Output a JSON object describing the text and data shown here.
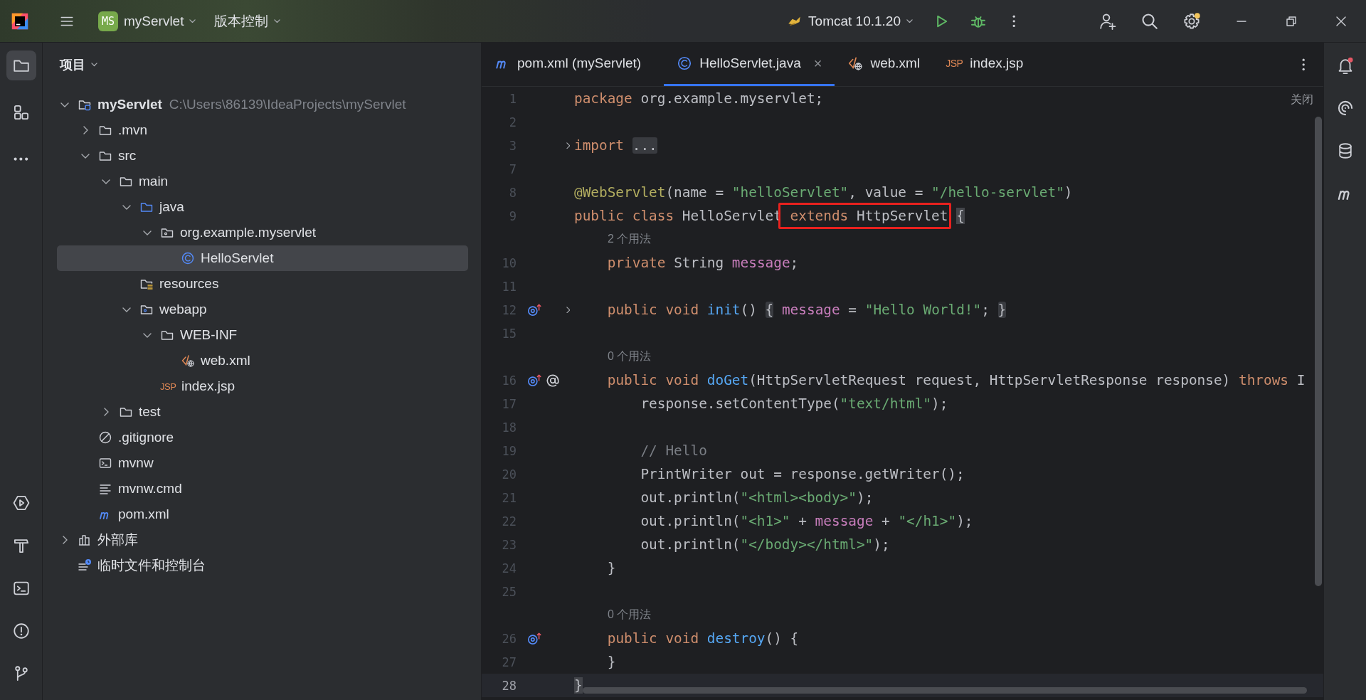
{
  "title_bar": {
    "project_badge": "MS",
    "project": "myServlet",
    "vcs": "版本控制",
    "run_config": "Tomcat 10.1.20"
  },
  "left_toolbar": {
    "top": [
      {
        "kind": "project",
        "selected": true
      },
      {
        "kind": "structure",
        "selected": false
      },
      {
        "kind": "more",
        "selected": false
      }
    ],
    "bottom": [
      {
        "kind": "services",
        "selected": false
      },
      {
        "kind": "build",
        "selected": false
      },
      {
        "kind": "terminal",
        "selected": false
      },
      {
        "kind": "problems",
        "selected": false
      },
      {
        "kind": "git",
        "selected": false
      }
    ]
  },
  "right_toolbar": [
    {
      "kind": "notifications",
      "selected": false
    },
    {
      "kind": "ai",
      "selected": false
    },
    {
      "kind": "database",
      "selected": false
    },
    {
      "kind": "maven",
      "selected": false
    }
  ],
  "project_panel": {
    "title": "项目",
    "tree": [
      {
        "label": "myServlet",
        "path": "C:\\Users\\86139\\IdeaProjects\\myServlet",
        "kind": "project",
        "expanded": true,
        "selected": false,
        "children": [
          {
            "label": ".mvn",
            "kind": "folder",
            "expanded": false,
            "selected": false
          },
          {
            "label": "src",
            "kind": "folder",
            "expanded": true,
            "selected": false,
            "children": [
              {
                "label": "main",
                "kind": "folder",
                "expanded": true,
                "selected": false,
                "children": [
                  {
                    "label": "java",
                    "kind": "source",
                    "expanded": true,
                    "selected": false,
                    "children": [
                      {
                        "label": "org.example.myservlet",
                        "kind": "package",
                        "expanded": true,
                        "selected": false,
                        "children": [
                          {
                            "label": "HelloServlet",
                            "kind": "class",
                            "selected": true
                          }
                        ]
                      }
                    ]
                  },
                  {
                    "label": "resources",
                    "kind": "resources",
                    "selected": false
                  },
                  {
                    "label": "webapp",
                    "kind": "web",
                    "expanded": true,
                    "selected": false,
                    "children": [
                      {
                        "label": "WEB-INF",
                        "kind": "folder",
                        "expanded": true,
                        "selected": false,
                        "children": [
                          {
                            "label": "web.xml",
                            "kind": "xml",
                            "selected": false
                          }
                        ]
                      },
                      {
                        "label": "index.jsp",
                        "kind": "jsp",
                        "icon_text": "JSP",
                        "selected": false
                      }
                    ]
                  }
                ]
              },
              {
                "label": "test",
                "kind": "folder",
                "expanded": false,
                "selected": false
              }
            ]
          },
          {
            "label": ".gitignore",
            "kind": "ignore",
            "selected": false
          },
          {
            "label": "mvnw",
            "kind": "script",
            "selected": false
          },
          {
            "label": "mvnw.cmd",
            "kind": "text",
            "selected": false
          },
          {
            "label": "pom.xml",
            "kind": "maven",
            "selected": false
          }
        ]
      },
      {
        "label": "外部库",
        "kind": "library",
        "expanded": false,
        "selected": false
      },
      {
        "label": "临时文件和控制台",
        "kind": "scratches",
        "selected": false
      }
    ]
  },
  "editor": {
    "tabs": [
      {
        "label": "pom.xml (myServlet)",
        "kind": "maven",
        "selected": false
      },
      {
        "label": "HelloServlet.java",
        "kind": "class",
        "selected": true,
        "close": "×"
      },
      {
        "label": "web.xml",
        "kind": "xml",
        "selected": false
      },
      {
        "label": "index.jsp",
        "kind": "jsp",
        "icon_text": "JSP",
        "selected": false
      }
    ],
    "reader_mode": "关闭",
    "lines": [
      {
        "kind": "code",
        "number": "1",
        "current": false,
        "tokens": [
          {
            "kind": "kw",
            "text": "package"
          },
          {
            "kind": "plain",
            "text": " org.example.myservlet;"
          }
        ]
      },
      {
        "kind": "code",
        "number": "2",
        "current": false
      },
      {
        "kind": "code",
        "number": "3",
        "current": false,
        "fold": true,
        "tokens": [
          {
            "kind": "kw",
            "text": "import"
          },
          {
            "kind": "fold",
            "text": " ..."
          }
        ]
      },
      {
        "kind": "code",
        "number": "7",
        "current": false
      },
      {
        "kind": "code",
        "number": "8",
        "current": false,
        "tokens": [
          {
            "kind": "ann",
            "text": "@WebServlet"
          },
          {
            "kind": "plain",
            "text": "(name ="
          },
          {
            "kind": "str",
            "text": " \"helloServlet\""
          },
          {
            "kind": "plain",
            "text": ", value ="
          },
          {
            "kind": "str",
            "text": " \"/hello-servlet\""
          },
          {
            "kind": "plain",
            "text": ")"
          }
        ]
      },
      {
        "kind": "code",
        "number": "9",
        "current": false,
        "tokens": [
          {
            "kind": "kw",
            "text": "public class"
          },
          {
            "kind": "plain",
            "text": " HelloServlet"
          },
          {
            "kind": "box",
            "parts": [
              {
                "kind": "kw",
                "text": " extends"
              },
              {
                "kind": "plain",
                "text": " HttpServlet"
              }
            ]
          },
          {
            "kind": "brace",
            "text": " {"
          }
        ]
      },
      {
        "kind": "hint",
        "text": "2 个用法"
      },
      {
        "kind": "code",
        "number": "10",
        "current": false,
        "tokens": [
          {
            "kind": "kw",
            "text": "    private"
          },
          {
            "kind": "plain",
            "text": " String"
          },
          {
            "kind": "field",
            "text": " message"
          },
          {
            "kind": "plain",
            "text": ";"
          }
        ]
      },
      {
        "kind": "code",
        "number": "11",
        "current": false
      },
      {
        "kind": "code",
        "number": "12",
        "current": false,
        "fold": true,
        "markers": [
          {
            "kind": "override"
          }
        ],
        "tokens": [
          {
            "kind": "kw",
            "text": "    public void"
          },
          {
            "kind": "method",
            "text": " init"
          },
          {
            "kind": "plain",
            "text": "()"
          },
          {
            "kind": "fold",
            "text": " {"
          },
          {
            "kind": "field",
            "text": " message"
          },
          {
            "kind": "plain",
            "text": " ="
          },
          {
            "kind": "str",
            "text": " \"Hello World!\""
          },
          {
            "kind": "plain",
            "text": ";"
          },
          {
            "kind": "fold",
            "text": " }"
          }
        ]
      },
      {
        "kind": "code",
        "number": "15",
        "current": false
      },
      {
        "kind": "hint",
        "text": "0 个用法"
      },
      {
        "kind": "code",
        "number": "16",
        "current": false,
        "markers": [
          {
            "kind": "override"
          },
          {
            "kind": "web"
          }
        ],
        "tokens": [
          {
            "kind": "kw",
            "text": "    public void"
          },
          {
            "kind": "method",
            "text": " doGet"
          },
          {
            "kind": "plain",
            "text": "(HttpServletRequest request, HttpServletResponse response)"
          },
          {
            "kind": "kw",
            "text": " throws"
          },
          {
            "kind": "plain",
            "text": " I"
          }
        ]
      },
      {
        "kind": "code",
        "number": "17",
        "current": false,
        "tokens": [
          {
            "kind": "plain",
            "text": "        response.setContentType("
          },
          {
            "kind": "str",
            "text": "\"text/html\""
          },
          {
            "kind": "plain",
            "text": ");"
          }
        ]
      },
      {
        "kind": "code",
        "number": "18",
        "current": false
      },
      {
        "kind": "code",
        "number": "19",
        "current": false,
        "tokens": [
          {
            "kind": "comment",
            "text": "        // Hello"
          }
        ]
      },
      {
        "kind": "code",
        "number": "20",
        "current": false,
        "tokens": [
          {
            "kind": "plain",
            "text": "        PrintWriter out = response.getWriter();"
          }
        ]
      },
      {
        "kind": "code",
        "number": "21",
        "current": false,
        "tokens": [
          {
            "kind": "plain",
            "text": "        out.println("
          },
          {
            "kind": "str",
            "text": "\"<html><body>\""
          },
          {
            "kind": "plain",
            "text": ");"
          }
        ]
      },
      {
        "kind": "code",
        "number": "22",
        "current": false,
        "tokens": [
          {
            "kind": "plain",
            "text": "        out.println("
          },
          {
            "kind": "str",
            "text": "\"<h1>\""
          },
          {
            "kind": "plain",
            "text": " +"
          },
          {
            "kind": "field",
            "text": " message"
          },
          {
            "kind": "plain",
            "text": " +"
          },
          {
            "kind": "str",
            "text": " \"</h1>\""
          },
          {
            "kind": "plain",
            "text": ");"
          }
        ]
      },
      {
        "kind": "code",
        "number": "23",
        "current": false,
        "tokens": [
          {
            "kind": "plain",
            "text": "        out.println("
          },
          {
            "kind": "str",
            "text": "\"</body></html>\""
          },
          {
            "kind": "plain",
            "text": ");"
          }
        ]
      },
      {
        "kind": "code",
        "number": "24",
        "current": false,
        "tokens": [
          {
            "kind": "plain",
            "text": "    }"
          }
        ]
      },
      {
        "kind": "code",
        "number": "25",
        "current": false
      },
      {
        "kind": "hint",
        "text": "0 个用法"
      },
      {
        "kind": "code",
        "number": "26",
        "current": false,
        "markers": [
          {
            "kind": "override"
          }
        ],
        "tokens": [
          {
            "kind": "kw",
            "text": "    public void"
          },
          {
            "kind": "method",
            "text": " destroy"
          },
          {
            "kind": "plain",
            "text": "() {"
          }
        ]
      },
      {
        "kind": "code",
        "number": "27",
        "current": false,
        "tokens": [
          {
            "kind": "plain",
            "text": "    }"
          }
        ]
      },
      {
        "kind": "code",
        "number": "28",
        "current": true,
        "tokens": [
          {
            "kind": "brace",
            "text": "}"
          }
        ]
      }
    ]
  }
}
